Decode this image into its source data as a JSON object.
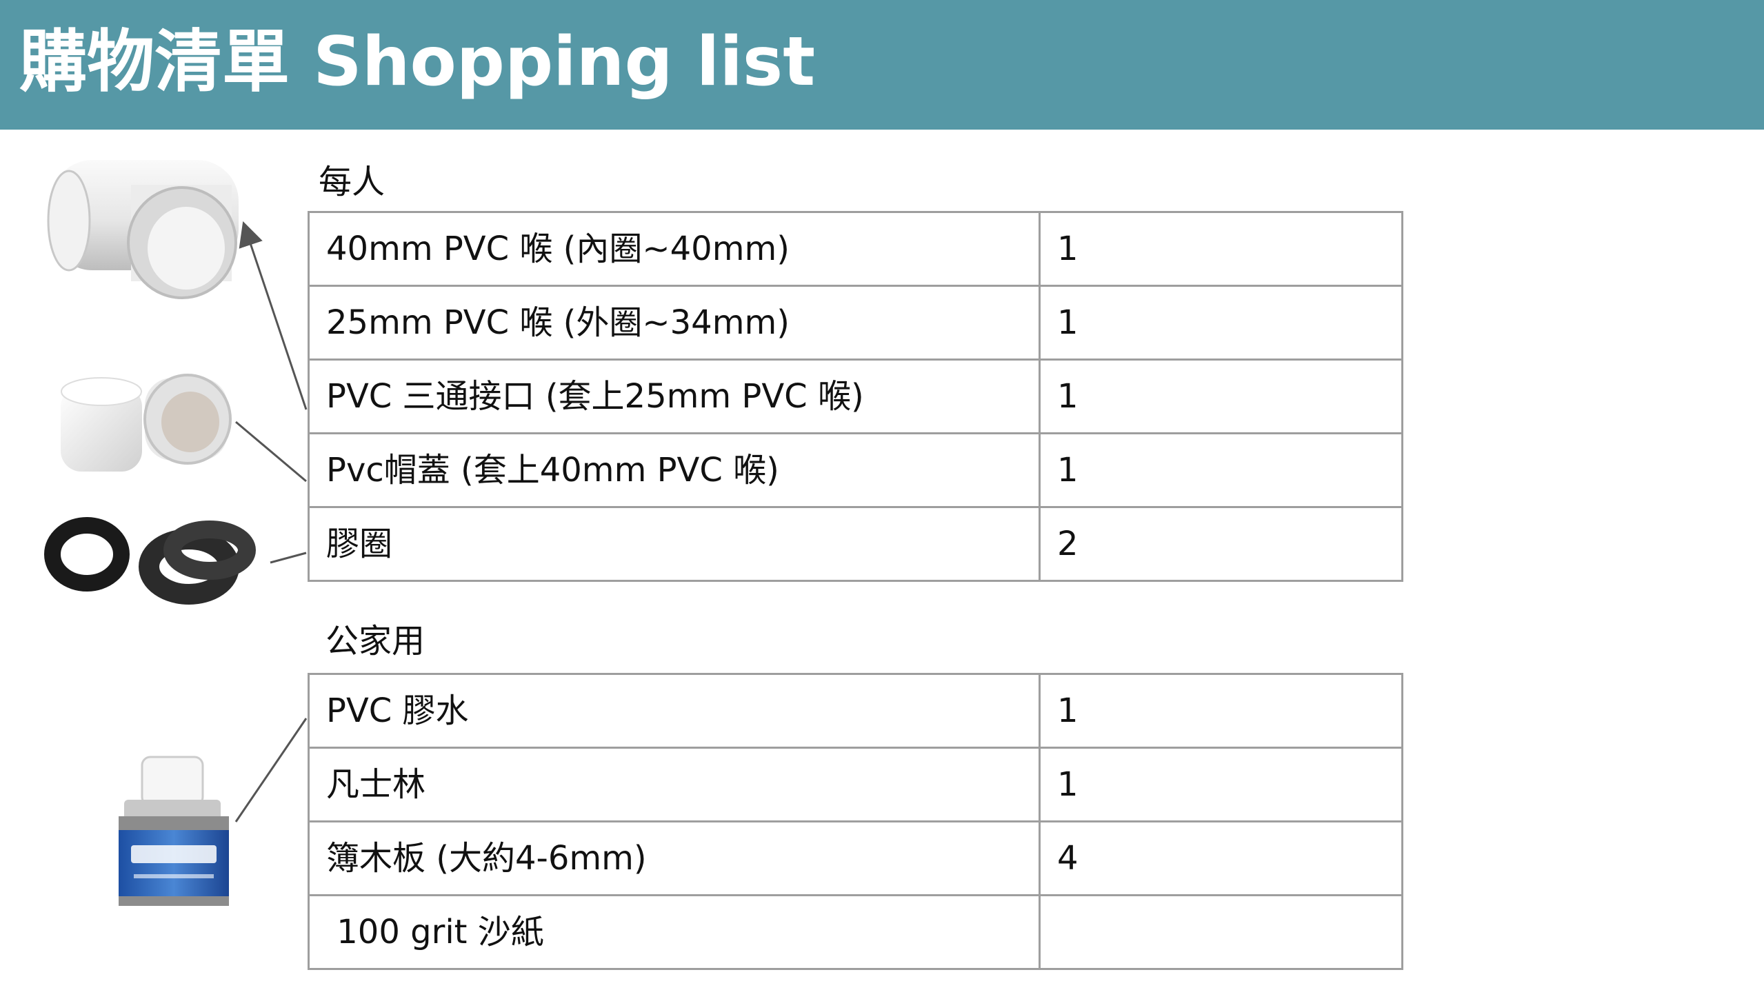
{
  "header": {
    "title": "購物清單 Shopping list"
  },
  "per_person": {
    "label": "每人",
    "rows": [
      {
        "item": "40mm PVC 喉 (內圈~40mm)",
        "qty": "1"
      },
      {
        "item": "25mm PVC 喉 (外圈~34mm)",
        "qty": "1"
      },
      {
        "item": "PVC 三通接口 (套上25mm PVC 喉)",
        "qty": "1"
      },
      {
        "item": "Pvc帽蓋 (套上40mm PVC 喉)",
        "qty": "1"
      },
      {
        "item": "膠圈",
        "qty": "2"
      }
    ]
  },
  "shared": {
    "label": "公家用",
    "rows": [
      {
        "item": "PVC 膠水",
        "qty": "1"
      },
      {
        "item": "凡士林",
        "qty": "1"
      },
      {
        "item": "簿木板 (大約4-6mm)",
        "qty": "4"
      },
      {
        "item": " 100 grit 沙紙",
        "qty": ""
      }
    ]
  },
  "illustrations": {
    "tee": "pvc-tee-joint-icon",
    "caps": "pvc-caps-icon",
    "rings": "rubber-rings-icon",
    "glue": "pvc-glue-can-icon"
  },
  "colors": {
    "header": "#5698a6",
    "table_border": "#9e9e9e"
  }
}
